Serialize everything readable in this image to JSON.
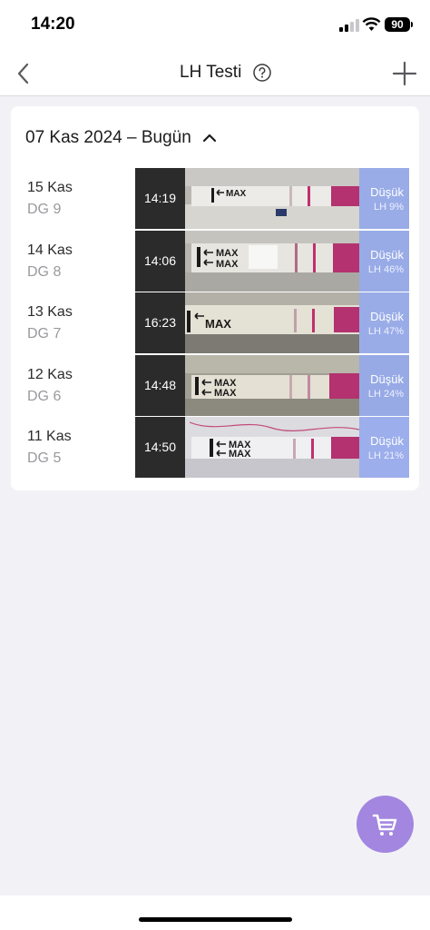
{
  "status_bar": {
    "time": "14:20",
    "battery": "90"
  },
  "nav": {
    "title": "LH Testi"
  },
  "section": {
    "date_range": "07 Kas 2024 – Bugün"
  },
  "entries": [
    {
      "date": "15 Kas",
      "cycle_day": "DG 9",
      "time": "14:19",
      "level": "Düşük",
      "lh": "LH 9%"
    },
    {
      "date": "14 Kas",
      "cycle_day": "DG 8",
      "time": "14:06",
      "level": "Düşük",
      "lh": "LH 46%"
    },
    {
      "date": "13 Kas",
      "cycle_day": "DG 7",
      "time": "16:23",
      "level": "Düşük",
      "lh": "LH 47%"
    },
    {
      "date": "12 Kas",
      "cycle_day": "DG 6",
      "time": "14:48",
      "level": "Düşük",
      "lh": "LH 24%"
    },
    {
      "date": "11 Kas",
      "cycle_day": "DG 5",
      "time": "14:50",
      "level": "Düşük",
      "lh": "LH 21%"
    }
  ],
  "strip_label": "MAX",
  "colors": {
    "accent": "#a386e0",
    "result_overlay": "#96aaeb",
    "test_line": "#c0306e"
  }
}
